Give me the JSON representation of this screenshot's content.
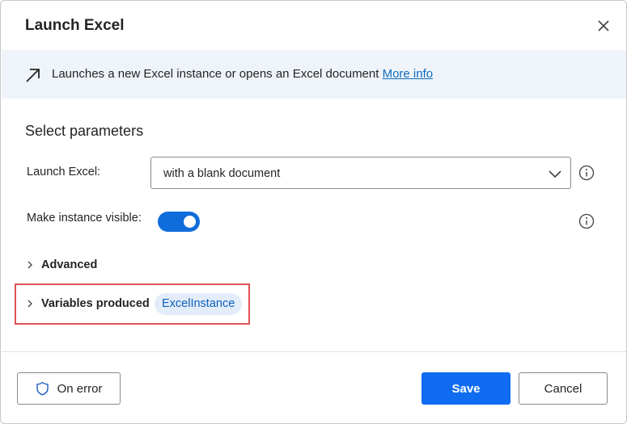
{
  "dialog": {
    "title": "Launch Excel",
    "close_icon": "close-icon"
  },
  "info": {
    "icon": "arrow-up-right-icon",
    "description": "Launches a new Excel instance or opens an Excel document",
    "more_info": "More info"
  },
  "parameters": {
    "section_title": "Select parameters",
    "launch_excel": {
      "label": "Launch Excel:",
      "value": "with a blank document"
    },
    "visible": {
      "label": "Make instance visible:",
      "enabled": true
    }
  },
  "advanced": {
    "label": "Advanced"
  },
  "variables": {
    "label": "Variables produced",
    "chip": "ExcelInstance"
  },
  "footer": {
    "on_error": "On error",
    "save": "Save",
    "cancel": "Cancel"
  },
  "colors": {
    "accent": "#0f6cf0",
    "banner_bg": "#eff4fb",
    "chip_bg": "#e3edf9",
    "highlight": "#e05252"
  }
}
